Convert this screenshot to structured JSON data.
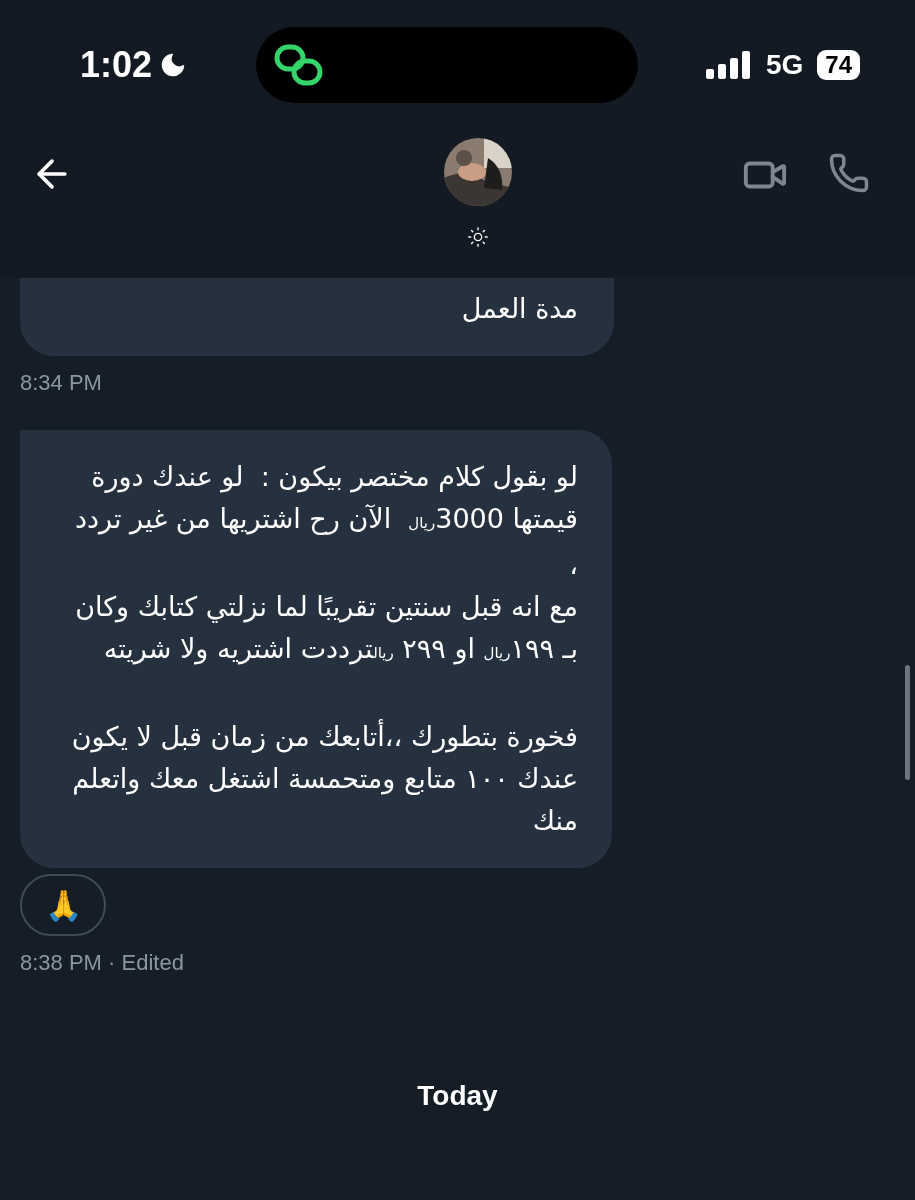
{
  "status_bar": {
    "time": "1:02",
    "network": "5G",
    "battery": "74"
  },
  "messages": [
    {
      "text": "مدة العمل",
      "meta": "8:34 PM"
    },
    {
      "text": "لو بقول كلام مختصر بيكون :  لو عندك دورة قيمتها 3000$_{ريال}$  الآن رح اشتريها من غير تردد ،\nمع انه قبل سنتين تقريبًا لما نزلتي كتابك وكان بـ ١٩٩$_{ريال}$ او ٢٩٩ $_{ريال}$ترددت اشتريه ولا شريته\n\nفخورة بتطورك ،،أتابعك من زمان قبل لا يكون عندك ١٠٠ متابع ومتحمسة اشتغل معك واتعلم منك",
      "reaction": "🙏",
      "meta": "8:38 PM · Edited"
    }
  ],
  "date_divider": "Today"
}
